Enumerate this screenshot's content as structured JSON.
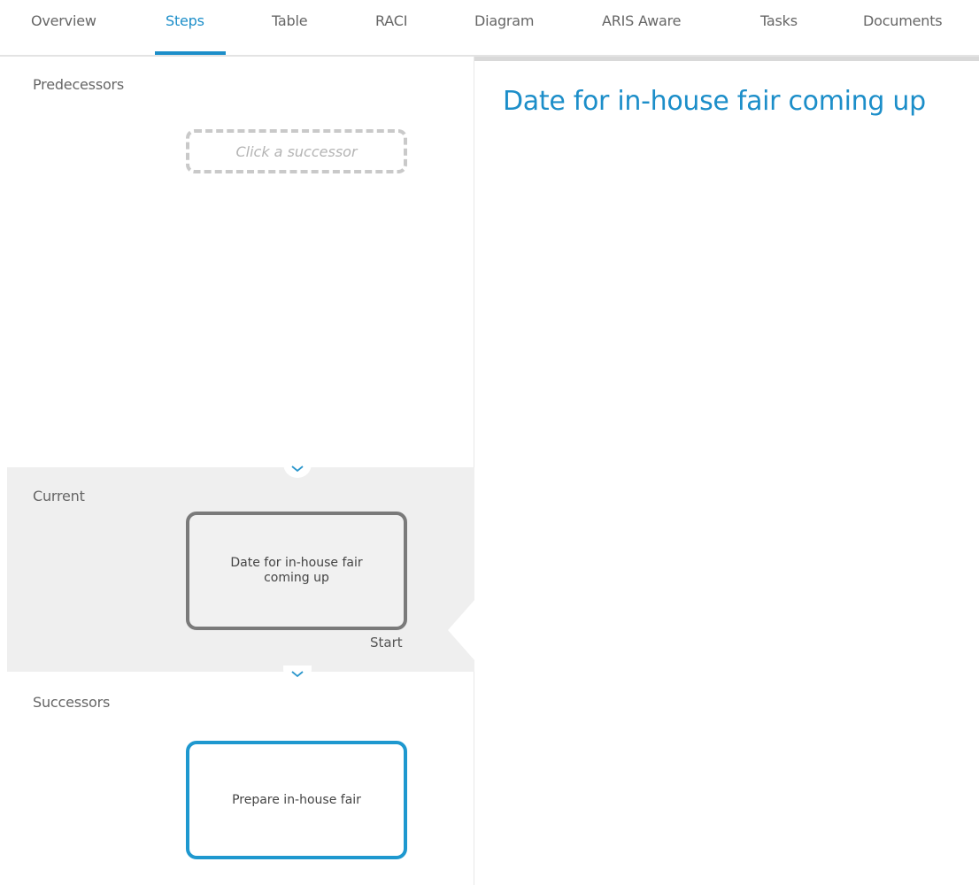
{
  "tabs": [
    {
      "label": "Overview",
      "active": false
    },
    {
      "label": "Steps",
      "active": true
    },
    {
      "label": "Table",
      "active": false
    },
    {
      "label": "RACI",
      "active": false
    },
    {
      "label": "Diagram",
      "active": false
    },
    {
      "label": "ARIS Aware",
      "active": false
    },
    {
      "label": "Tasks",
      "active": false
    },
    {
      "label": "Documents",
      "active": false
    }
  ],
  "steps": {
    "predecessors_label": "Predecessors",
    "predecessor_placeholder": "Click a successor",
    "current_label": "Current",
    "current_step": "Date for in-house fair coming up",
    "current_step_type": "Start",
    "successors_label": "Successors",
    "successor_step": "Prepare in-house fair"
  },
  "detail": {
    "title": "Date for in-house fair coming up"
  },
  "icons": {
    "expand": "chevron-down-icon"
  },
  "colors": {
    "accent": "#1c8ec9",
    "current_border": "#7a7a7a",
    "successor_border": "#1e98cf",
    "current_band_bg": "#efefef"
  }
}
